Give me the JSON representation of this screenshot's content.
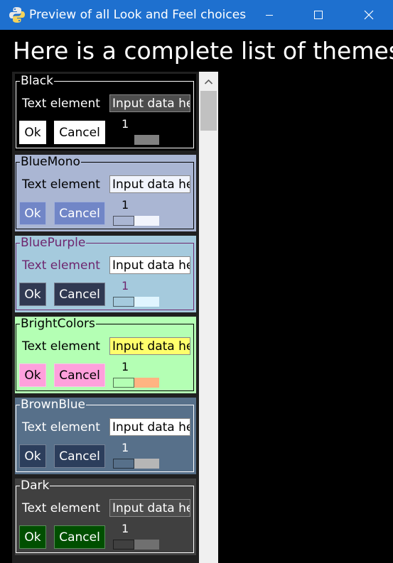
{
  "window": {
    "title": "Preview of all Look and Feel choices"
  },
  "heading": "Here is a complete list of themes",
  "themes": [
    {
      "name": "Black",
      "text_label": "Text element",
      "input_value": "Input data here",
      "ok_label": "Ok",
      "cancel_label": "Cancel",
      "slider_value": "1",
      "colors": {
        "background": "#000000",
        "text": "#ffffff",
        "input_bg": "#4d4d4d",
        "input_text": "#ffffff",
        "button_bg": "#ffffff",
        "button_text": "#000000",
        "slider_trough": "#808080",
        "slider_handle": "#000000"
      }
    },
    {
      "name": "BlueMono",
      "text_label": "Text element",
      "input_value": "Input data here",
      "ok_label": "Ok",
      "cancel_label": "Cancel",
      "slider_value": "1",
      "colors": {
        "background": "#aab6d3",
        "text": "#000000",
        "input_bg": "#f1f4fc",
        "input_text": "#000000",
        "button_bg": "#7186c7",
        "button_text": "#ffffff",
        "slider_trough": "#f1f4fc",
        "slider_handle": "#aab6d3"
      }
    },
    {
      "name": "BluePurple",
      "text_label": "Text element",
      "input_value": "Input data here",
      "ok_label": "Ok",
      "cancel_label": "Cancel",
      "slider_value": "1",
      "colors": {
        "background": "#a5cadd",
        "text": "#6e266e",
        "input_bg": "#ffffff",
        "input_text": "#000000",
        "button_bg": "#303952",
        "button_text": "#ffffff",
        "slider_trough": "#e0f5ff",
        "slider_handle": "#a5cadd"
      }
    },
    {
      "name": "BrightColors",
      "text_label": "Text element",
      "input_value": "Input data here",
      "ok_label": "Ok",
      "cancel_label": "Cancel",
      "slider_value": "1",
      "colors": {
        "background": "#b4ffb4",
        "text": "#000000",
        "input_bg": "#ffff6c",
        "input_text": "#000000",
        "button_bg": "#ffa0dc",
        "button_text": "#000000",
        "slider_trough": "#ffb482",
        "slider_handle": "#b4ffb4"
      }
    },
    {
      "name": "BrownBlue",
      "text_label": "Text element",
      "input_value": "Input data here",
      "ok_label": "Ok",
      "cancel_label": "Cancel",
      "slider_value": "1",
      "colors": {
        "background": "#57708a",
        "text": "#ffffff",
        "input_bg": "#ffffff",
        "input_text": "#000000",
        "button_bg": "#2c3e5c",
        "button_text": "#ffffff",
        "slider_trough": "#b6b6b6",
        "slider_handle": "#57708a"
      }
    },
    {
      "name": "Dark",
      "text_label": "Text element",
      "input_value": "Input data here",
      "ok_label": "Ok",
      "cancel_label": "Cancel",
      "slider_value": "1",
      "colors": {
        "background": "#404040",
        "text": "#ffffff",
        "input_bg": "#4d4d4d",
        "input_text": "#ffffff",
        "button_bg": "#004f00",
        "button_text": "#ffffff",
        "slider_trough": "#707070",
        "slider_handle": "#404040"
      }
    }
  ],
  "icons": {
    "app": "python-icon",
    "minimize": "minimize-icon",
    "maximize": "maximize-icon",
    "close": "close-icon",
    "scroll_up": "chevron-up-icon"
  }
}
